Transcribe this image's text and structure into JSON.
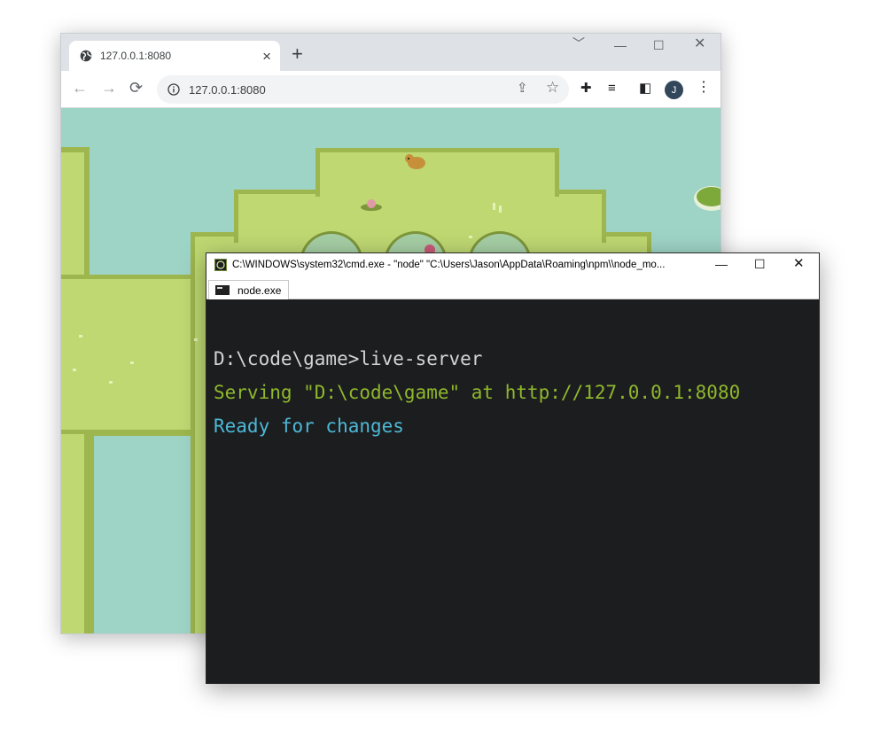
{
  "browser": {
    "tab_title": "127.0.0.1:8080",
    "tab_close": "×",
    "new_tab": "+",
    "address": "127.0.0.1:8080",
    "profile_initial": "J",
    "icons": [
      "globe-icon",
      "back-arrow-icon",
      "forward-arrow-icon",
      "reload-icon",
      "info-icon",
      "share-icon",
      "star-icon",
      "extensions-icon",
      "media-icon",
      "side-panel-icon",
      "menu-icon"
    ],
    "window_controls": {
      "chevron": "﹀",
      "minimize": "—",
      "maximize": "☐",
      "close": "✕"
    }
  },
  "game": {
    "scene": "pixel-art grass island with water, bushes, bird and flowers",
    "colors": {
      "water": "#9ed4c6",
      "grass": "#bfd872",
      "grass_edge": "#9db64e",
      "grass_dark": "#7d963b",
      "bush": "#a6cfa5"
    }
  },
  "terminal": {
    "title": "C:\\WINDOWS\\system32\\cmd.exe  - \"node\"   \"C:\\Users\\Jason\\AppData\\Roaming\\npm\\\\node_mo...",
    "tab_label": "node.exe",
    "window_controls": {
      "minimize": "—",
      "maximize": "☐",
      "close": "✕"
    },
    "lines": [
      {
        "text": "D:\\code\\game>live-server",
        "color": "#d4d4d4"
      },
      {
        "text": "Serving \"D:\\code\\game\" at http://127.0.0.1:8080",
        "color": "#8fb82c"
      },
      {
        "text": "Ready for changes",
        "color": "#4cb8d6"
      }
    ]
  }
}
